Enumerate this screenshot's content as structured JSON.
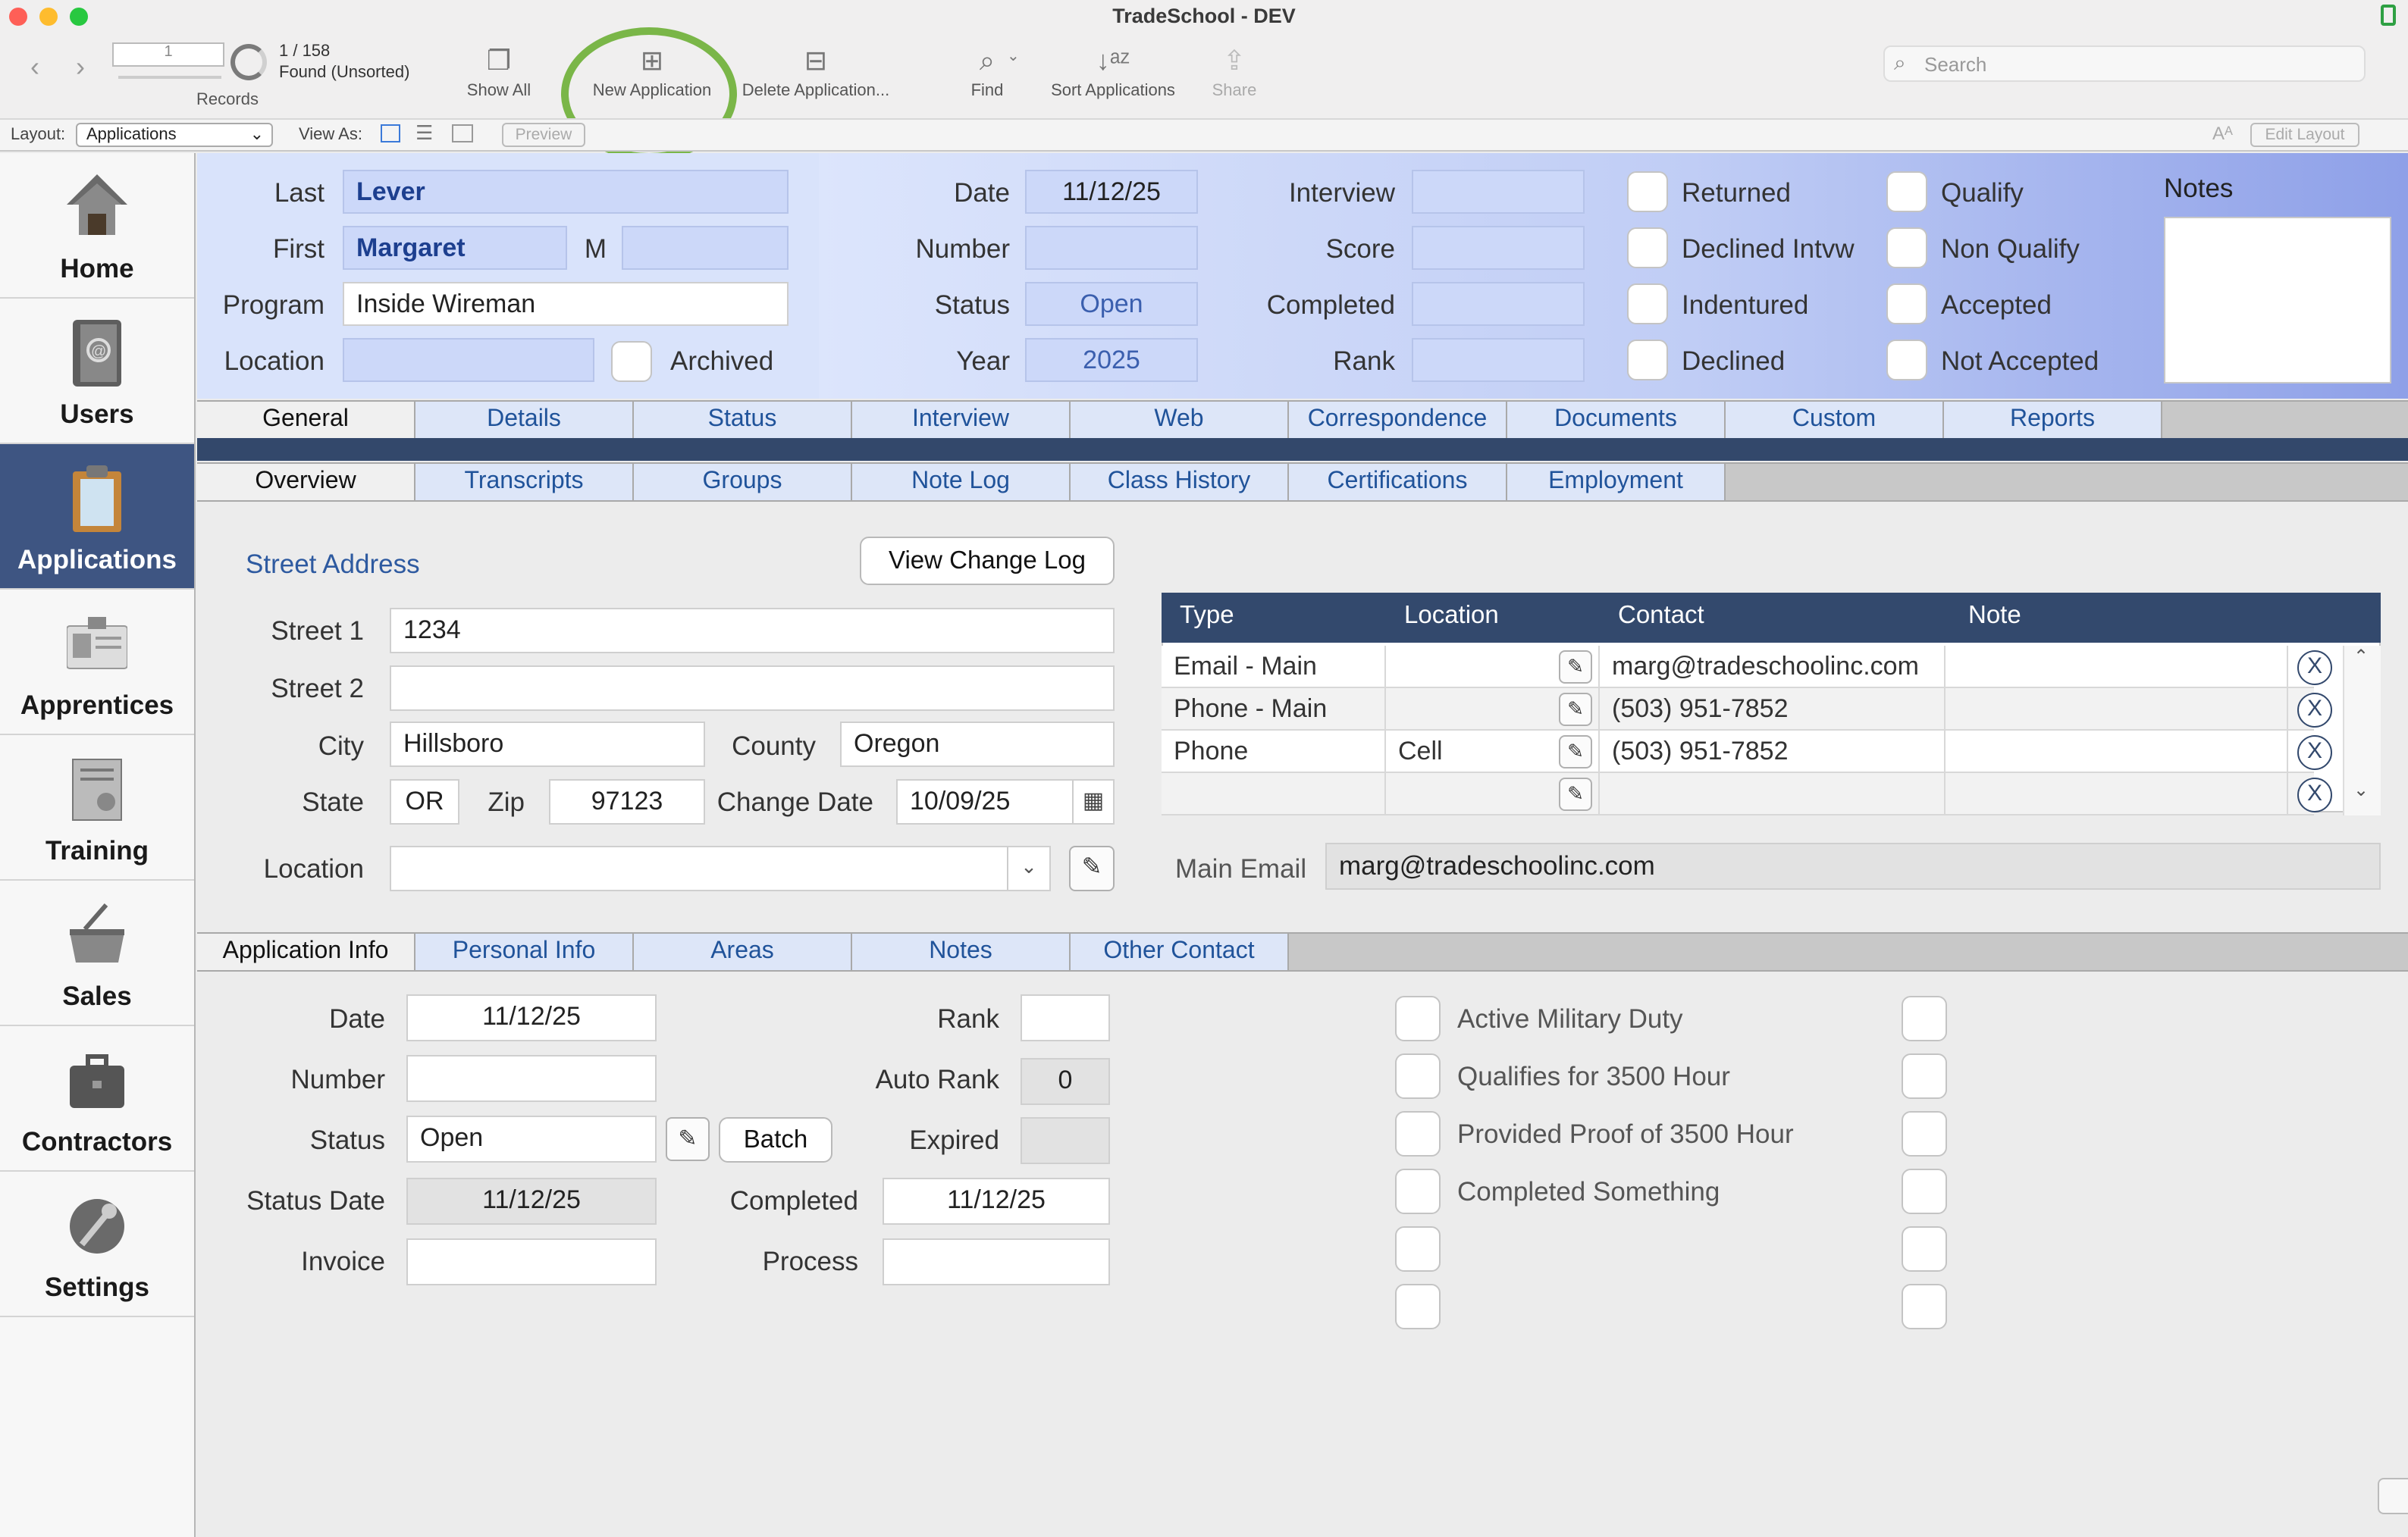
{
  "window": {
    "title": "TradeSchool - DEV"
  },
  "toolbar": {
    "record_box": "1",
    "record_count": "1 / 158",
    "found_status": "Found (Unsorted)",
    "records_label": "Records",
    "show_all": "Show All",
    "new_application": "New Application",
    "delete_application": "Delete Application...",
    "find": "Find",
    "sort": "Sort Applications",
    "share": "Share",
    "search_placeholder": "Search"
  },
  "layoutbar": {
    "layout_label": "Layout:",
    "layout_value": "Applications",
    "view_as": "View As:",
    "preview": "Preview",
    "edit_layout": "Edit Layout",
    "font_icon": "Aᴬ"
  },
  "sidebar": {
    "items": [
      {
        "label": "Home",
        "icon": "house-icon"
      },
      {
        "label": "Users",
        "icon": "address-book-icon"
      },
      {
        "label": "Applications",
        "icon": "clipboard-icon"
      },
      {
        "label": "Apprentices",
        "icon": "id-badge-icon"
      },
      {
        "label": "Training",
        "icon": "certificate-icon"
      },
      {
        "label": "Sales",
        "icon": "basket-icon"
      },
      {
        "label": "Contractors",
        "icon": "briefcase-icon"
      },
      {
        "label": "Settings",
        "icon": "wrench-icon"
      }
    ]
  },
  "header": {
    "last_label": "Last",
    "last": "Lever",
    "first_label": "First",
    "first": "Margaret",
    "middle_label": "M",
    "middle": "",
    "program_label": "Program",
    "program": "Inside Wireman",
    "location_label": "Location",
    "location": "",
    "archived": "Archived",
    "date_label": "Date",
    "date": "11/12/25",
    "number_label": "Number",
    "number": "",
    "status_label": "Status",
    "status": "Open",
    "year_label": "Year",
    "year": "2025",
    "interview_label": "Interview",
    "interview": "",
    "score_label": "Score",
    "score": "",
    "completed_label": "Completed",
    "completed": "",
    "rank_label": "Rank",
    "rank": "",
    "checks": [
      "Returned",
      "Qualify",
      "Declined Intvw",
      "Non Qualify",
      "Indentured",
      "Accepted",
      "Declined",
      "Not Accepted"
    ],
    "notes_label": "Notes",
    "notes": ""
  },
  "main_tabs": [
    "General",
    "Details",
    "Status",
    "Interview",
    "Web",
    "Correspondence",
    "Documents",
    "Custom",
    "Reports"
  ],
  "sub_tabs": [
    "Overview",
    "Transcripts",
    "Groups",
    "Note Log",
    "Class History",
    "Certifications",
    "Employment"
  ],
  "address": {
    "section": "Street Address",
    "change_log_button": "View Change Log",
    "street1_label": "Street 1",
    "street1": "1234",
    "street2_label": "Street 2",
    "street2": "",
    "city_label": "City",
    "city": "Hillsboro",
    "county_label": "County",
    "county": "Oregon",
    "state_label": "State",
    "state": "OR",
    "zip_label": "Zip",
    "zip": "97123",
    "change_date_label": "Change Date",
    "change_date": "10/09/25",
    "location_label": "Location",
    "location": ""
  },
  "contacts": {
    "headers": [
      "Type",
      "Location",
      "Contact",
      "Note"
    ],
    "rows": [
      {
        "type": "Email - Main",
        "location": "",
        "contact": "marg@tradeschoolinc.com",
        "note": ""
      },
      {
        "type": "Phone - Main",
        "location": "",
        "contact": "(503) 951-7852",
        "note": ""
      },
      {
        "type": "Phone",
        "location": "Cell",
        "contact": "(503) 951-7852",
        "note": ""
      },
      {
        "type": "",
        "location": "",
        "contact": "",
        "note": ""
      }
    ],
    "delete_glyph": "X",
    "main_email_label": "Main Email",
    "main_email": "marg@tradeschoolinc.com"
  },
  "info_tabs": [
    "Application Info",
    "Personal Info",
    "Areas",
    "Notes",
    "Other Contact"
  ],
  "app_info": {
    "date_label": "Date",
    "date": "11/12/25",
    "number_label": "Number",
    "number": "",
    "status_label": "Status",
    "status": "Open",
    "batch_button": "Batch",
    "status_date_label": "Status Date",
    "status_date": "11/12/25",
    "invoice_label": "Invoice",
    "invoice": "",
    "rank_label": "Rank",
    "rank": "",
    "auto_rank_label": "Auto Rank",
    "auto_rank": "0",
    "expired_label": "Expired",
    "expired": "",
    "completed_label": "Completed",
    "completed": "11/12/25",
    "process_label": "Process",
    "process": "",
    "checks": [
      "Active Military Duty",
      "Qualifies for 3500 Hour",
      "Provided Proof of 3500 Hour",
      "Completed Something",
      "",
      ""
    ]
  },
  "colors": {
    "accent": "#33496d",
    "sidebar_active": "#3e5582",
    "header_field": "#ccd8f9",
    "tab_text": "#20539a",
    "highlight_circle": "#7ab648"
  }
}
